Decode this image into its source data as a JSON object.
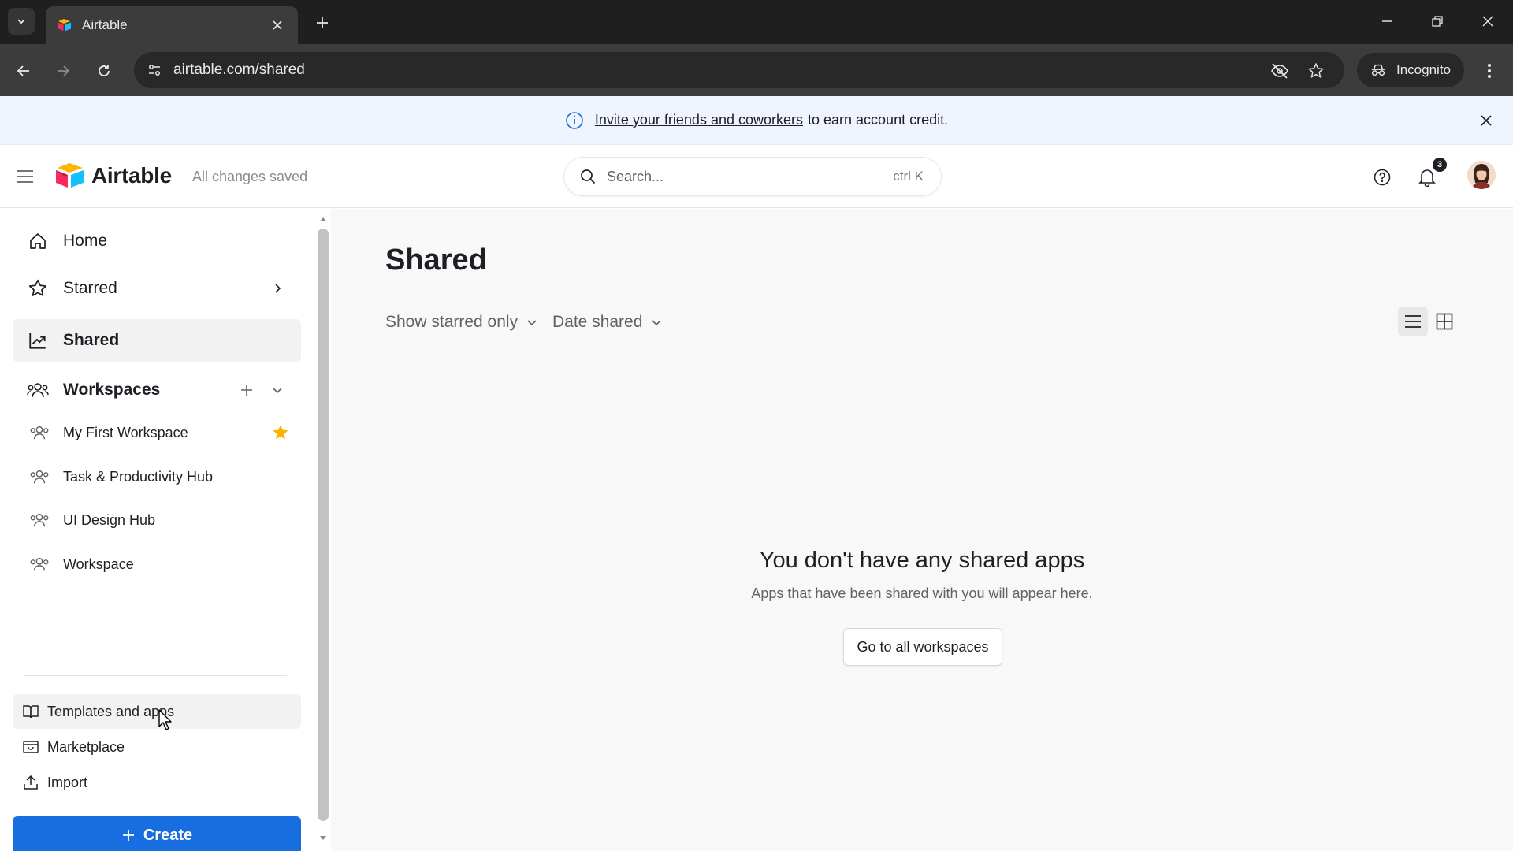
{
  "browser": {
    "tab_title": "Airtable",
    "url": "airtable.com/shared",
    "incognito_label": "Incognito"
  },
  "banner": {
    "link_text": "Invite your friends and coworkers",
    "rest_text": "to earn account credit."
  },
  "header": {
    "logo_text": "Airtable",
    "save_status": "All changes saved",
    "search_placeholder": "Search...",
    "search_shortcut": "ctrl K",
    "notification_count": "3"
  },
  "sidebar": {
    "nav": [
      {
        "label": "Home",
        "icon": "home-icon"
      },
      {
        "label": "Starred",
        "icon": "star-icon"
      },
      {
        "label": "Shared",
        "icon": "shared-icon"
      },
      {
        "label": "Workspaces",
        "icon": "workspaces-icon"
      }
    ],
    "workspaces": [
      {
        "label": "My First Workspace",
        "starred": true
      },
      {
        "label": "Task & Productivity Hub",
        "starred": false
      },
      {
        "label": "UI Design Hub",
        "starred": false
      },
      {
        "label": "Workspace",
        "starred": false
      }
    ],
    "bottom": [
      {
        "label": "Templates and apps",
        "icon": "book-icon"
      },
      {
        "label": "Marketplace",
        "icon": "marketplace-icon"
      },
      {
        "label": "Import",
        "icon": "upload-icon"
      }
    ],
    "create_label": "Create"
  },
  "main": {
    "title": "Shared",
    "filters": [
      {
        "label": "Show starred only"
      },
      {
        "label": "Date shared"
      }
    ],
    "empty_state": {
      "title": "You don't have any shared apps",
      "subtitle": "Apps that have been shared with you will appear here.",
      "button_label": "Go to all workspaces"
    }
  },
  "colors": {
    "accent": "#166ee1",
    "star": "#fcb400",
    "banner_bg": "#f0f4fe"
  }
}
